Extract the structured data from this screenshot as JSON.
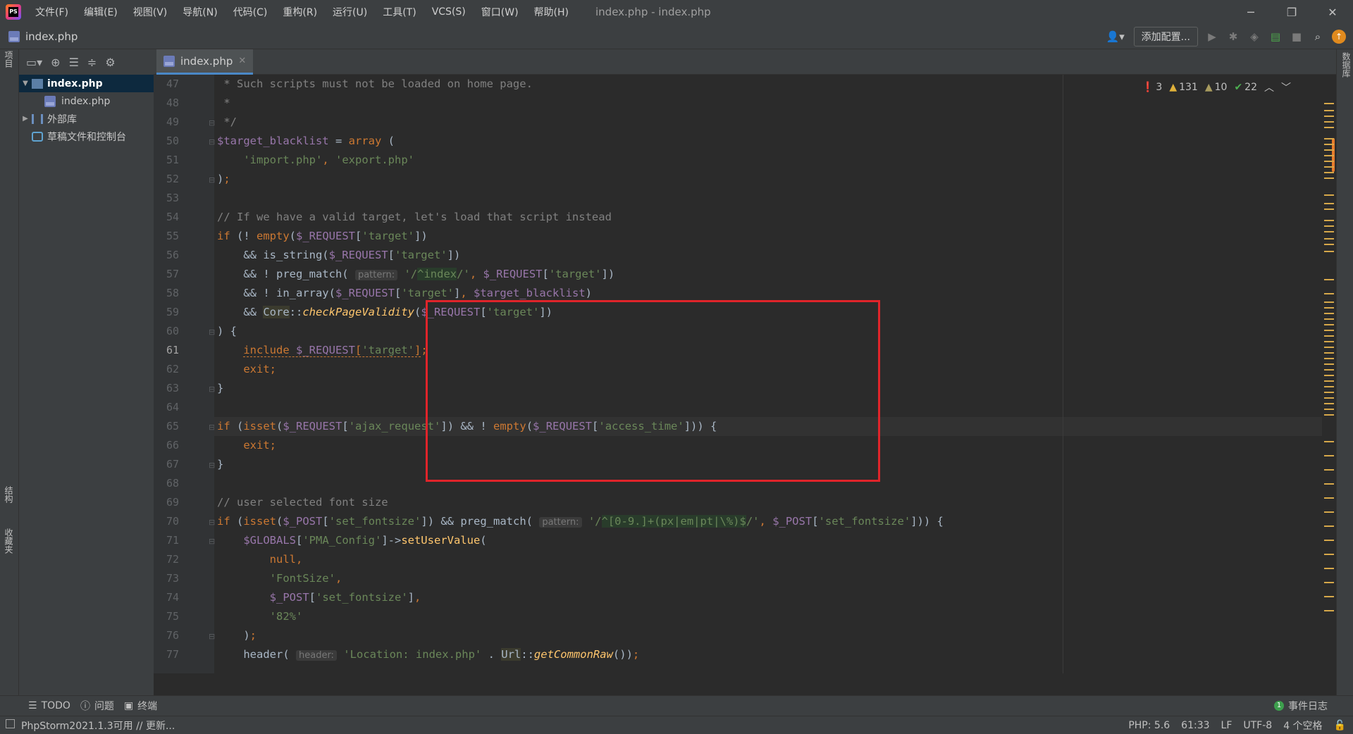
{
  "menubar": {
    "items": [
      "文件(F)",
      "编辑(E)",
      "视图(V)",
      "导航(N)",
      "代码(C)",
      "重构(R)",
      "运行(U)",
      "工具(T)",
      "VCS(S)",
      "窗口(W)",
      "帮助(H)"
    ],
    "window_title": "index.php - index.php"
  },
  "navbar": {
    "breadcrumb": "index.php",
    "add_config": "添加配置..."
  },
  "left_strip": {
    "project_tab": "项目",
    "structure_tab": "结构",
    "favorites_tab": "收藏夹"
  },
  "right_strip": {
    "database_tab": "数据库"
  },
  "project_tree": {
    "items": [
      {
        "label": "index.php",
        "kind": "folder",
        "expanded": true,
        "selected": true
      },
      {
        "label": "index.php",
        "kind": "php-file"
      },
      {
        "label": "外部库",
        "kind": "library"
      },
      {
        "label": "草稿文件和控制台",
        "kind": "scratches"
      }
    ]
  },
  "editor": {
    "tab_label": "index.php",
    "current_line": 61,
    "line_numbers": [
      "47",
      "48",
      "49",
      "50",
      "51",
      "52",
      "53",
      "54",
      "55",
      "56",
      "57",
      "58",
      "59",
      "60",
      "61",
      "62",
      "63",
      "64",
      "65",
      "66",
      "67",
      "68",
      "69",
      "70",
      "71",
      "72",
      "73",
      "74",
      "75",
      "76",
      "77"
    ],
    "hint_pattern": "pattern:",
    "hint_header": "header:"
  },
  "inspections": {
    "errors": "3",
    "warnings": "131",
    "weak_warnings": "10",
    "typos": "22"
  },
  "tool_windows": {
    "todo": "TODO",
    "problems": "问题",
    "terminal": "终端",
    "event_log": "事件日志",
    "event_count": "1"
  },
  "status": {
    "message": "PhpStorm2021.1.3可用 // 更新...",
    "php_version": "PHP: 5.6",
    "position": "61:33",
    "line_sep": "LF",
    "encoding": "UTF-8",
    "indent": "4 个空格"
  },
  "colors": {
    "accent": "#4a88c7",
    "highlight_box": "#e0242a",
    "keyword": "#cc7832",
    "string": "#6a8759",
    "variable": "#9876aa",
    "function": "#ffc66d"
  }
}
